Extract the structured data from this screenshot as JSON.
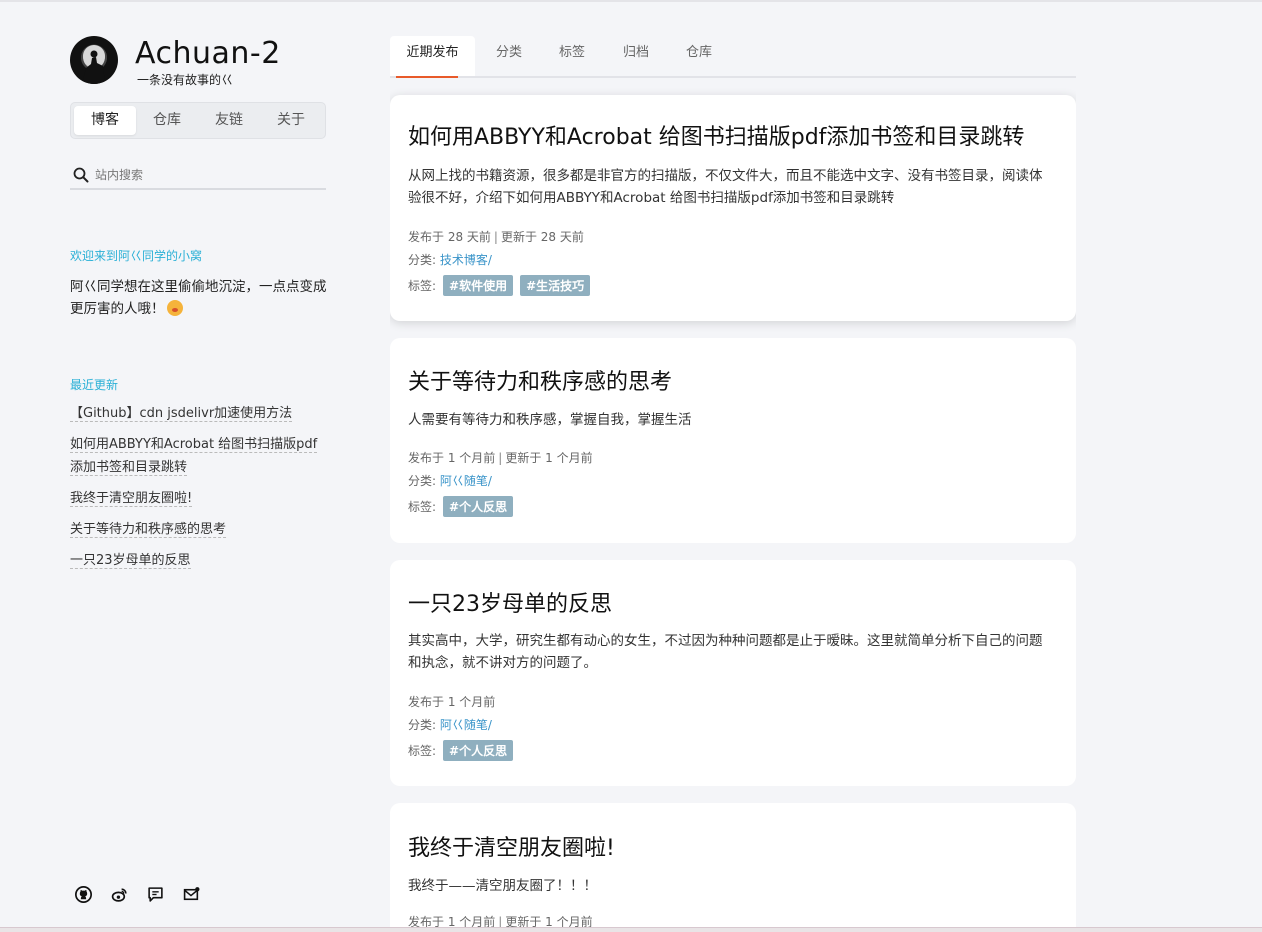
{
  "site": {
    "title": "Achuan-2",
    "subtitle": "一条没有故事的巜"
  },
  "nav": [
    "博客",
    "仓库",
    "友链",
    "关于"
  ],
  "search": {
    "placeholder": "站内搜索"
  },
  "welcome": {
    "title": "欢迎来到阿巜同学的小窝",
    "text": "阿巜同学想在这里偷偷地沉淀，一点点变成更厉害的人哦！"
  },
  "recent": {
    "title": "最近更新",
    "items": [
      "【Github】cdn jsdelivr加速使用方法",
      "如何用ABBYY和Acrobat 给图书扫描版pdf添加书签和目录跳转",
      "我终于清空朋友圈啦!",
      "关于等待力和秩序感的思考",
      "一只23岁母单的反思"
    ]
  },
  "social_icons": [
    "github-icon",
    "weibo-icon",
    "message-icon",
    "email-icon"
  ],
  "tabs": [
    "近期发布",
    "分类",
    "标签",
    "归档",
    "仓库"
  ],
  "labels": {
    "category": "分类:",
    "tags": "标签:",
    "sep": "|"
  },
  "posts": [
    {
      "title": "如何用ABBYY和Acrobat 给图书扫描版pdf添加书签和目录跳转",
      "excerpt": "从网上找的书籍资源，很多都是非官方的扫描版，不仅文件大，而且不能选中文字、没有书签目录，阅读体验很不好，介绍下如何用ABBYY和Acrobat 给图书扫描版pdf添加书签和目录跳转",
      "published": "发布于 28 天前",
      "updated": "更新于 28 天前",
      "category": "技术博客/",
      "tags": [
        "#软件使用",
        "#生活技巧"
      ]
    },
    {
      "title": "关于等待力和秩序感的思考",
      "excerpt": "人需要有等待力和秩序感，掌握自我，掌握生活",
      "published": "发布于 1 个月前",
      "updated": "更新于 1 个月前",
      "category": "阿巜随笔/",
      "tags": [
        "#个人反思"
      ]
    },
    {
      "title": "一只23岁母单的反思",
      "excerpt": "其实高中，大学，研究生都有动心的女生，不过因为种种问题都是止于暧昧。这里就简单分析下自己的问题和执念，就不讲对方的问题了。",
      "published": "发布于 1 个月前",
      "category": "阿巜随笔/",
      "tags": [
        "#个人反思"
      ]
    },
    {
      "title": "我终于清空朋友圈啦!",
      "excerpt": "我终于——清空朋友圈了！！！",
      "published": "发布于 1 个月前",
      "updated": "更新于 1 个月前"
    }
  ],
  "colors": {
    "accent": "#e85a2a",
    "link": "#3a94c9",
    "section_title": "#2ab0d6",
    "tag_bg": "#8fafbf",
    "background": "#f4f5f8"
  }
}
